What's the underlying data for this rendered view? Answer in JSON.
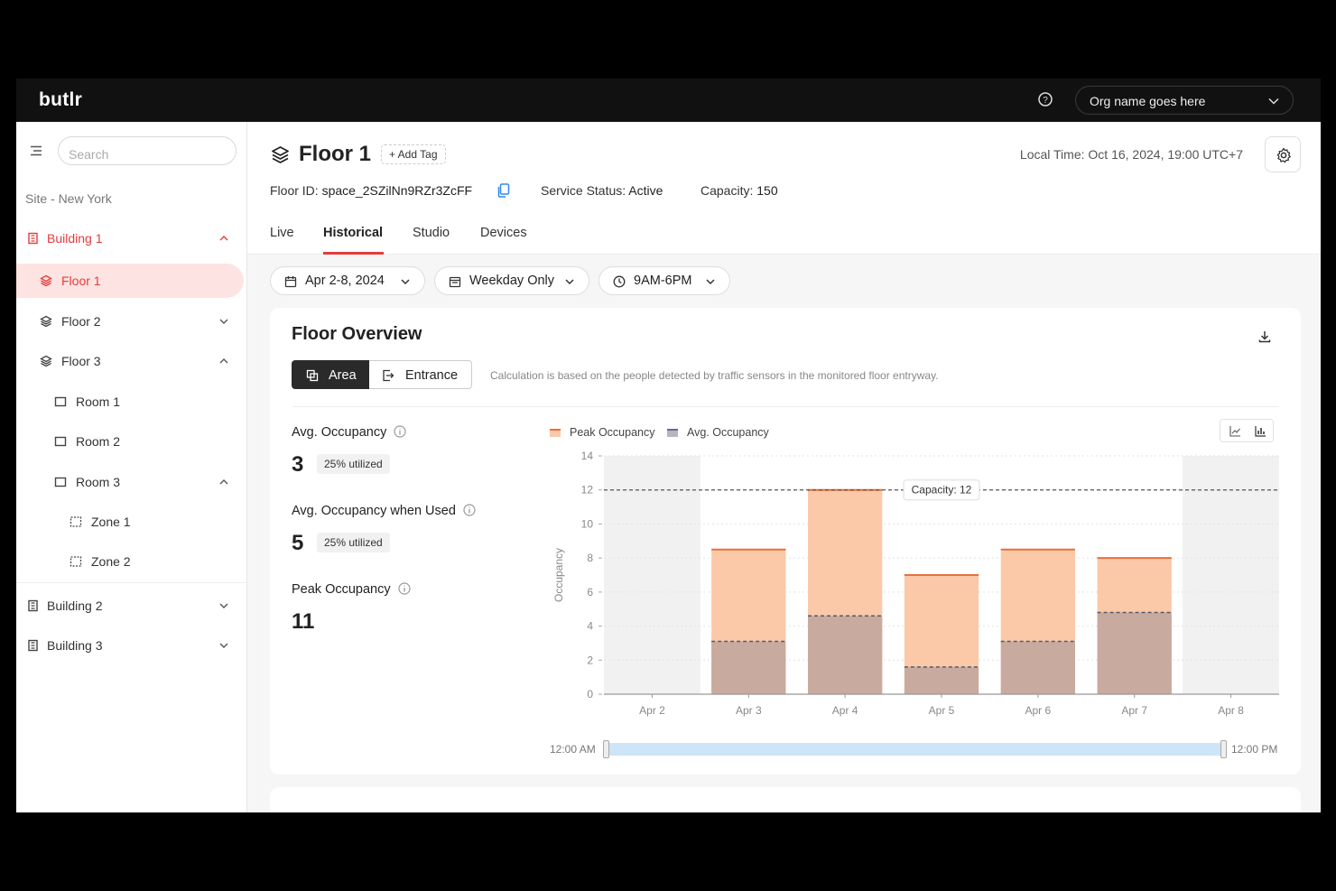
{
  "app": {
    "logo": "butlr"
  },
  "topbar": {
    "org_name": "Org name goes here"
  },
  "sidebar": {
    "search_placeholder": "Search",
    "site_label": "Site - New York",
    "items": [
      {
        "label": "Building 1"
      },
      {
        "label": "Floor 1"
      },
      {
        "label": "Floor 2"
      },
      {
        "label": "Floor 3"
      },
      {
        "label": "Room 1"
      },
      {
        "label": "Room 2"
      },
      {
        "label": "Room 3"
      },
      {
        "label": "Zone 1"
      },
      {
        "label": "Zone 2"
      },
      {
        "label": "Building 2"
      },
      {
        "label": "Building 3"
      }
    ]
  },
  "header": {
    "title": "Floor 1",
    "add_tag": "+ Add Tag",
    "local_time": "Local Time: Oct 16, 2024, 19:00 UTC+7",
    "floor_id_label": "Floor ID:",
    "floor_id": "space_2SZilNn9RZr3ZcFF",
    "status_label": "Service Status:",
    "status": "Active",
    "capacity_label": "Capacity:",
    "capacity": "150"
  },
  "tabs": [
    "Live",
    "Historical",
    "Studio",
    "Devices"
  ],
  "filters": {
    "date_range": "Apr 2-8, 2024",
    "days": "Weekday Only",
    "hours": "9AM-6PM"
  },
  "card": {
    "title": "Floor Overview",
    "toggle_area": "Area",
    "toggle_entrance": "Entrance",
    "note": "Calculation is based on the people detected by traffic sensors in the monitored floor entryway."
  },
  "stats": {
    "avg_label": "Avg. Occupancy",
    "avg_value": "3",
    "avg_util": "25% utilized",
    "avg_used_label": "Avg. Occupancy when Used",
    "avg_used_value": "5",
    "avg_used_util": "25% utilized",
    "peak_label": "Peak Occupancy",
    "peak_value": "11"
  },
  "legend": {
    "peak": "Peak Occupancy",
    "avg": "Avg. Occupancy"
  },
  "range": {
    "start": "12:00 AM",
    "end": "12:00 PM"
  },
  "colors": {
    "accent": "#e43c3c",
    "peak_fill": "#fbc8a8",
    "avg_fill": "#c9aa9e",
    "peak_line": "#e8703a"
  },
  "chart_data": {
    "type": "bar",
    "categories": [
      "Apr 2",
      "Apr 3",
      "Apr 4",
      "Apr 5",
      "Apr 6",
      "Apr 7",
      "Apr 8"
    ],
    "series": [
      {
        "name": "Peak Occupancy",
        "values": [
          null,
          8.5,
          12,
          7,
          8.5,
          8,
          null
        ]
      },
      {
        "name": "Avg. Occupancy",
        "values": [
          null,
          3.1,
          4.6,
          1.6,
          3.1,
          4.8,
          null
        ]
      }
    ],
    "ylabel": "Occupancy",
    "ylim": [
      0,
      14
    ],
    "yticks": [
      0,
      2,
      4,
      6,
      8,
      10,
      12,
      14
    ],
    "capacity_line": 12,
    "capacity_label": "Capacity: 12",
    "shaded_categories": [
      "Apr 2",
      "Apr 8"
    ],
    "grid": true
  }
}
